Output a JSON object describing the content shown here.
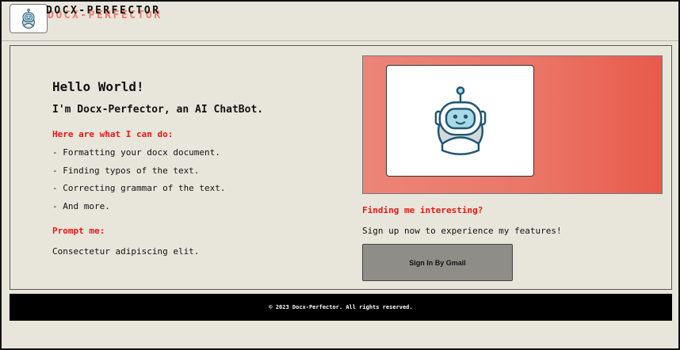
{
  "header": {
    "brand": "DOCX-PERFECTOR",
    "logo_icon": "robot-icon"
  },
  "main": {
    "hello": "Hello World!",
    "intro": "I'm Docx-Perfector, an AI ChatBot.",
    "can_do_label": "Here are what I can do:",
    "features": [
      "- Formatting your docx document.",
      "- Finding typos of the text.",
      "- Correcting grammar of the text.",
      "- And more."
    ],
    "prompt_label": "Prompt me:",
    "prompt_text": "Consectetur adipiscing elit.",
    "hero_icon": "robot-icon",
    "interesting_label": "Finding me interesting?",
    "signup_text": "Sign up now to experience my features!",
    "gmail_button": "Sign In By Gmail"
  },
  "footer": {
    "text": "© 2023 Docx-Perfector. All rights reserved."
  },
  "colors": {
    "background": "#e8e6db",
    "accent_red": "#f01414",
    "hero_gradient_start": "#ec8478",
    "hero_gradient_end": "#e85a4b",
    "robot_stroke": "#1f5672",
    "robot_face": "#a8d9e6",
    "button": "#8f8d88",
    "footer": "#000000"
  }
}
